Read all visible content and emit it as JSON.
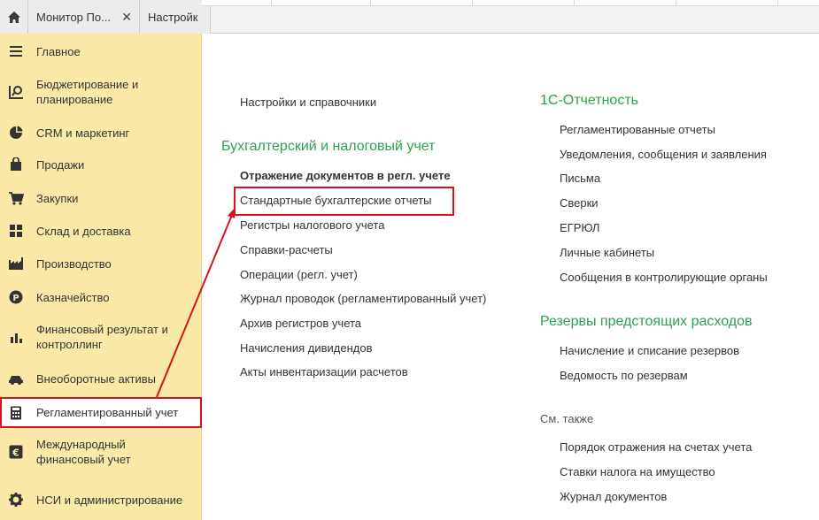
{
  "tabs": {
    "home_icon": "home-icon",
    "tab1_label": "Монитор По...",
    "tab1_close": "✕",
    "tab2_label": "Настройк"
  },
  "sidebar": {
    "items": [
      {
        "label": "Главное",
        "icon": "menu-icon"
      },
      {
        "label": "Бюджетирование и планирование",
        "icon": "budget-chart-icon"
      },
      {
        "label": "CRM и маркетинг",
        "icon": "pie-chart-icon"
      },
      {
        "label": "Продажи",
        "icon": "shopping-bag-icon"
      },
      {
        "label": "Закупки",
        "icon": "cart-icon"
      },
      {
        "label": "Склад и доставка",
        "icon": "warehouse-grid-icon"
      },
      {
        "label": "Производство",
        "icon": "factory-icon"
      },
      {
        "label": "Казначейство",
        "icon": "coin-icon"
      },
      {
        "label": "Финансовый результат и контроллинг",
        "icon": "bar-chart-icon"
      },
      {
        "label": "Внеоборотные активы",
        "icon": "car-icon"
      },
      {
        "label": "Регламентированный учет",
        "icon": "calculator-icon"
      },
      {
        "label": "Международный финансовый учет",
        "icon": "euro-icon"
      },
      {
        "label": "НСИ и администрирование",
        "icon": "gear-icon"
      }
    ]
  },
  "left_column": {
    "settings_link": "Настройки и справочники",
    "section_title": "Бухгалтерский и налоговый учет",
    "links": [
      "Отражение документов в регл. учете",
      "Стандартные бухгалтерские отчеты",
      "Регистры налогового учета",
      "Справки-расчеты",
      "Операции (регл. учет)",
      "Журнал проводок (регламентированный учет)",
      "Архив регистров учета",
      "Начисления дивидендов",
      "Акты инвентаризации расчетов"
    ]
  },
  "right_column": {
    "reporting_title": "1С-Отчетность",
    "reporting_links": [
      "Регламентированные отчеты",
      "Уведомления, сообщения и заявления",
      "Письма",
      "Сверки",
      "ЕГРЮЛ",
      "Личные кабинеты",
      "Сообщения в контролирующие органы"
    ],
    "reserves_title": "Резервы предстоящих расходов",
    "reserves_links": [
      "Начисление и списание резервов",
      "Ведомость по резервам"
    ],
    "see_also_title": "См. также",
    "see_also_links": [
      "Порядок отражения на счетах учета",
      "Ставки налога на имущество",
      "Журнал документов"
    ]
  },
  "colors": {
    "sidebar_bg": "#fbeaa7",
    "section_green": "#2ba24c",
    "highlight_red": "#d9101f"
  }
}
